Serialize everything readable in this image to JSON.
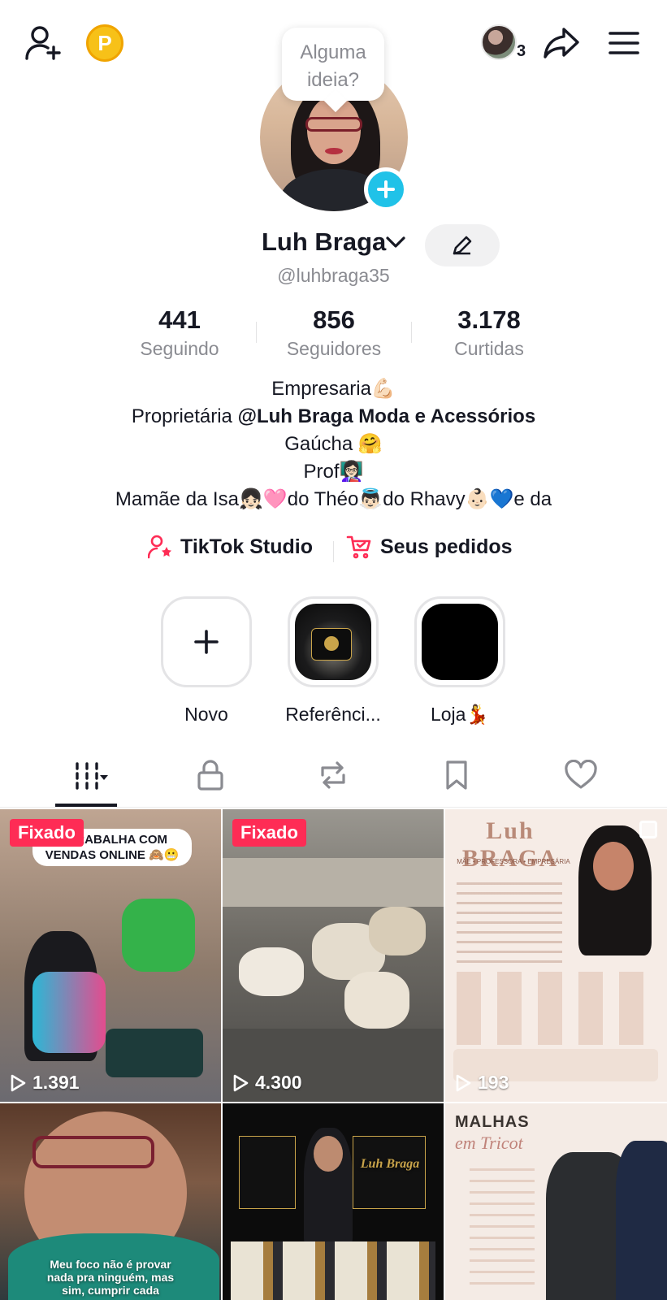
{
  "header": {
    "add_friend_icon": "person-plus-icon",
    "coin_label": "P",
    "followers_count_small": "3",
    "share_icon": "share-arrow-icon",
    "menu_icon": "hamburger-menu-icon"
  },
  "profile": {
    "tooltip_line1": "Alguma",
    "tooltip_line2": "ideia?",
    "name": "Luh Braga",
    "handle": "@luhbraga35"
  },
  "stats": [
    {
      "value": "441",
      "label": "Seguindo"
    },
    {
      "value": "856",
      "label": "Seguidores"
    },
    {
      "value": "3.178",
      "label": "Curtidas"
    }
  ],
  "bio": {
    "line1": "Empresaria💪🏻",
    "line2_prefix": "Proprietária ",
    "line2_bold": "@Luh Braga Moda e Acessórios",
    "line3": "Gaúcha 🤗",
    "line4": "Prof👩🏻‍🏫",
    "line5": "Mamãe da Isa👧🏻🩷do Théo👼🏻do Rhavy👶🏻💙e da"
  },
  "links": {
    "studio": "TikTok Studio",
    "orders": "Seus pedidos"
  },
  "stories": [
    {
      "label": "Novo"
    },
    {
      "label": "Referênci..."
    },
    {
      "label": "Loja💃"
    }
  ],
  "tabs": [
    "videos",
    "private",
    "reposts",
    "favorites",
    "liked"
  ],
  "videos": [
    {
      "pinned": "Fixado",
      "views": "1.391",
      "overlay": "E TRABALHA COM VENDAS ONLINE 🙈😬"
    },
    {
      "pinned": "Fixado",
      "views": "4.300"
    },
    {
      "views": "193",
      "title": "Luh BRAGA",
      "subtitle": "MÃE • PROFESSORA • EMPRESÁRIA"
    },
    {
      "overlay": "Meu foco não é provar nada pra ninguém, mas sim, cumprir cada"
    },
    {
      "overlay": "Luh Braga"
    },
    {
      "title1": "MALHAS",
      "title2": "em Tricot"
    }
  ],
  "colors": {
    "accent": "#fe2c55",
    "plus_badge": "#20c2e8",
    "coin": "#f7c118"
  }
}
